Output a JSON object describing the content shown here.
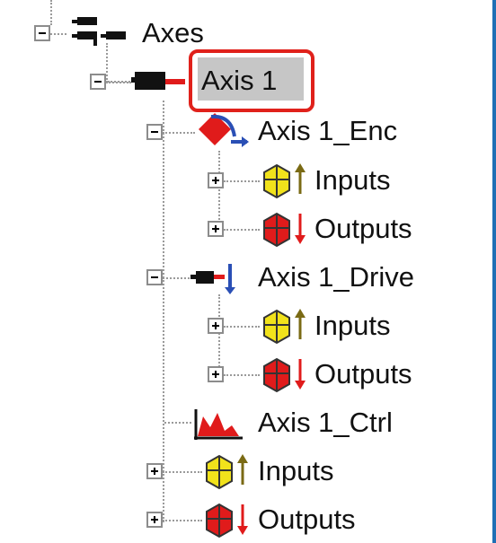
{
  "tree": {
    "root_label": "Axes",
    "axis1": {
      "label": "Axis 1",
      "encoder": {
        "label": "Axis 1_Enc",
        "inputs": "Inputs",
        "outputs": "Outputs"
      },
      "drive": {
        "label": "Axis 1_Drive",
        "inputs": "Inputs",
        "outputs": "Outputs"
      },
      "ctrl": {
        "label": "Axis 1_Ctrl"
      },
      "inputs": "Inputs",
      "outputs": "Outputs"
    }
  },
  "colors": {
    "selection_outline": "#e0211b",
    "selection_fill": "#c6c6c6",
    "frame_border": "#1f6fb5"
  }
}
